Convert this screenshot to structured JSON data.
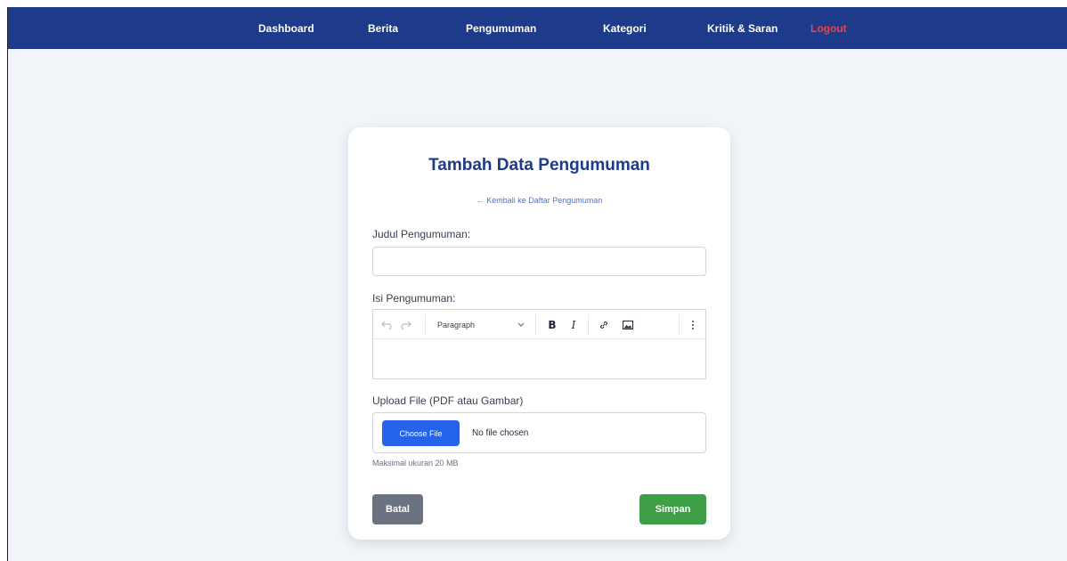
{
  "nav": {
    "items": [
      {
        "label": "Dashboard"
      },
      {
        "label": "Berita"
      },
      {
        "label": "Pengumuman"
      },
      {
        "label": "Kategori"
      },
      {
        "label": "Kritik & Saran"
      }
    ],
    "logout": "Logout"
  },
  "form": {
    "title": "Tambah Data Pengumuman",
    "back_link": "← Kembali ke Daftar Pengumuman",
    "judul_label": "Judul Pengumuman:",
    "judul_value": "",
    "isi_label": "Isi Pengumuman:",
    "editor": {
      "paragraph_select": "Paragraph",
      "bold": "B",
      "italic": "I",
      "undo_icon": "undo-icon",
      "redo_icon": "redo-icon",
      "link_icon": "link-icon",
      "image_icon": "image-icon",
      "more_icon": "more-vertical-icon",
      "content": ""
    },
    "upload_label": "Upload File (PDF atau Gambar)",
    "choose_file": "Choose File",
    "no_file": "No file chosen",
    "hint": "Maksimal ukuran 20 MB",
    "cancel": "Batal",
    "save": "Simpan"
  },
  "colors": {
    "navbar": "#1e3a8a",
    "title": "#1e3a8a",
    "logout": "#ef4444",
    "choose_button": "#2563eb",
    "cancel_button": "#6b7280",
    "save_button": "#3f9f47"
  }
}
